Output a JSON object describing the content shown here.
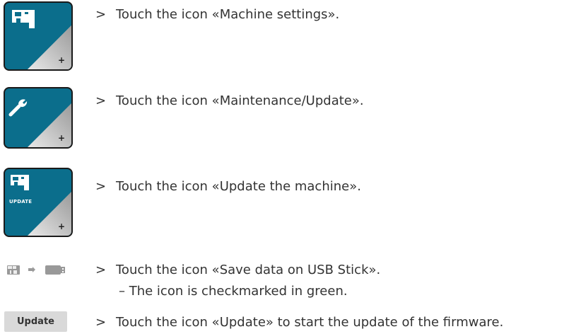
{
  "steps": [
    {
      "arrow": ">",
      "text": "Touch the icon «Machine settings».",
      "icon": "sewing-machine-icon"
    },
    {
      "arrow": ">",
      "text": "Touch the icon «Maintenance/Update».",
      "icon": "wrench-icon"
    },
    {
      "arrow": ">",
      "text": "Touch the icon «Update the machine».",
      "icon": "sewing-machine-icon",
      "icon_caption": "UPDATE"
    },
    {
      "arrow": ">",
      "text": "Touch the icon «Save data on USB Stick».",
      "result": "– The icon is checkmarked in green.",
      "icon": "save-to-usb-icon"
    },
    {
      "arrow": ">",
      "text": "Touch the icon «Update» to start the update of the firmware.",
      "button_label": "Update"
    }
  ],
  "colors": {
    "tile": "#0b6e8c",
    "button": "#d9d9d9"
  }
}
